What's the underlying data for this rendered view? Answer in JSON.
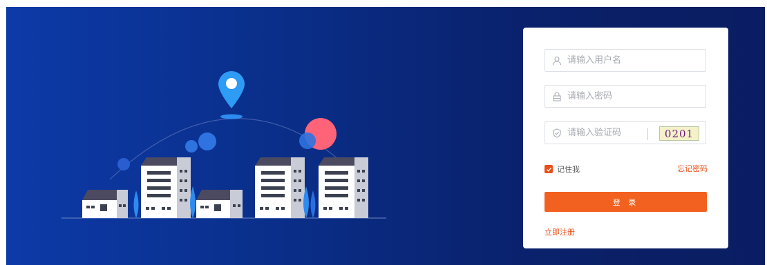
{
  "login": {
    "username_placeholder": "请输入用户名",
    "password_placeholder": "请输入密码",
    "captcha_placeholder": "请输入验证码",
    "captcha_text": "0201",
    "remember_label": "记住我",
    "forgot_label": "忘记密码",
    "submit_label": "登 录",
    "register_label": "立即注册"
  },
  "colors": {
    "accent": "#f26120",
    "banner_start": "#0d3aa8",
    "banner_end": "#0a1d63"
  },
  "icons": [
    "user-icon",
    "lock-icon",
    "shield-icon",
    "check-icon",
    "location-pin-icon"
  ]
}
